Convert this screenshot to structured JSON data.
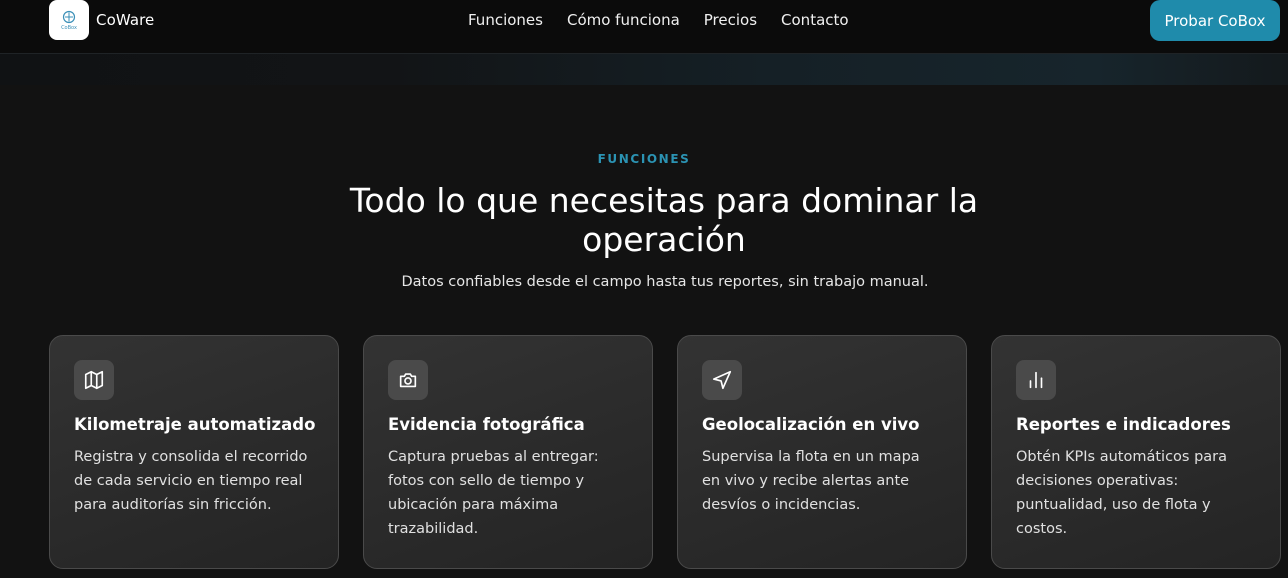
{
  "nav": {
    "logo_text": "CoBox",
    "brand": "CoWare",
    "links": [
      "Funciones",
      "Cómo funciona",
      "Precios",
      "Contacto"
    ],
    "cta": "Probar CoBox"
  },
  "section": {
    "eyebrow": "FUNCIONES",
    "title": "Todo lo que necesitas para dominar la operación",
    "subtitle": "Datos confiables desde el campo hasta tus reportes, sin trabajo manual."
  },
  "cards": [
    {
      "icon": "map-icon",
      "title": "Kilometraje automatizado",
      "desc": "Registra y consolida el recorrido de cada servicio en tiempo real para auditorías sin fricción."
    },
    {
      "icon": "camera-icon",
      "title": "Evidencia fotográfica",
      "desc": "Captura pruebas al entregar: fotos con sello de tiempo y ubicación para máxima trazabilidad."
    },
    {
      "icon": "navigation-icon",
      "title": "Geolocalización en vivo",
      "desc": "Supervisa la flota en un mapa en vivo y recibe alertas ante desvíos o incidencias."
    },
    {
      "icon": "bar-chart-icon",
      "title": "Reportes e indicadores",
      "desc": "Obtén KPIs automáticos para decisiones operativas: puntualidad, uso de flota y costos."
    }
  ],
  "colors": {
    "accent": "#1f8bab",
    "eyebrow": "#2b93b3",
    "background": "#121212",
    "card": "#2e2e2e"
  }
}
